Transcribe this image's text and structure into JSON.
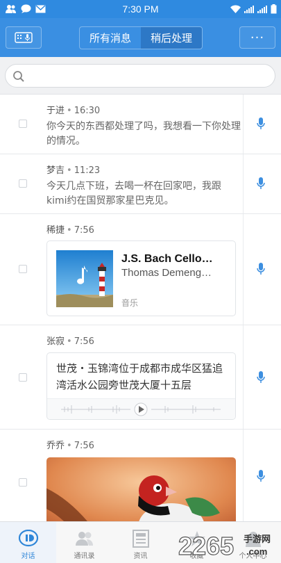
{
  "status_bar": {
    "time": "7:30 PM"
  },
  "header": {
    "segments": [
      {
        "label": "所有消息",
        "active": false
      },
      {
        "label": "稍后处理",
        "active": true
      }
    ],
    "more_label": "···"
  },
  "search": {
    "placeholder": "",
    "value": ""
  },
  "messages": [
    {
      "sender": "于进",
      "time": "16:30",
      "text": "你今天的东西都处理了吗，我想看一下你处理的情况。"
    },
    {
      "sender": "梦吉",
      "time": "11:23",
      "text": "今天几点下班，去喝一杯在回家吧，我跟kimi约在国贸那家星巴克见。"
    },
    {
      "sender": "稀捷",
      "time": "7:56",
      "card": {
        "title": "J.S. Bach Cello…",
        "artist": "Thomas Demeng…",
        "type": "音乐"
      }
    },
    {
      "sender": "张寂",
      "time": "7:56",
      "card": {
        "text": "世茂・玉锦湾位于成都市成华区猛追湾活水公园旁世茂大厦十五层"
      }
    },
    {
      "sender": "乔乔",
      "time": "7:56"
    }
  ],
  "tabs": [
    {
      "label": "对话",
      "icon": "chat-icon",
      "active": true
    },
    {
      "label": "通讯录",
      "icon": "contacts-icon",
      "active": false
    },
    {
      "label": "资讯",
      "icon": "news-icon",
      "active": false
    },
    {
      "label": "收藏",
      "icon": "favorites-icon",
      "active": false
    },
    {
      "label": "个人中心",
      "icon": "profile-icon",
      "active": false
    }
  ],
  "watermark": {
    "text": "2265",
    "suffix": ".com",
    "site": "手游网"
  },
  "colors": {
    "accent": "#3a8fe2",
    "mic": "#3d8fe0"
  }
}
